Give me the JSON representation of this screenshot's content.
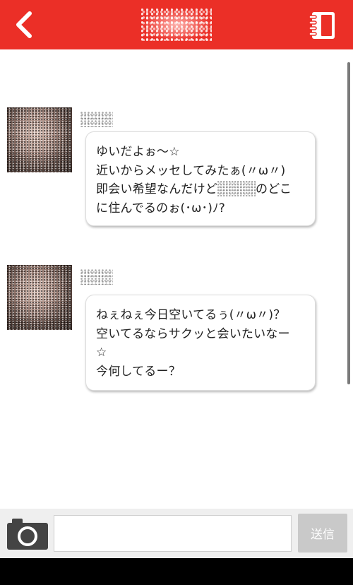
{
  "header": {
    "title": "",
    "back_icon": "chevron-left-icon",
    "menu_icon": "notebook-icon",
    "color": "#eb2f27"
  },
  "messages": [
    {
      "sender": "",
      "lines": [
        "ゆいだよぉ～☆",
        "近いからメッセしてみたぁ(〃ω〃)",
        "即会い希望なんだけど",
        "のどこ",
        "に住んでるのぉ(･ω･)ﾉ?"
      ]
    },
    {
      "sender": "",
      "lines": [
        "ねぇねぇ今日空いてるぅ(〃ω〃)？",
        "空いてるならサクッと会いたいなー",
        "☆",
        "今何してるー？"
      ]
    }
  ],
  "composer": {
    "camera_icon": "camera-icon",
    "input_value": "",
    "input_placeholder": "",
    "send_label": "送信"
  }
}
